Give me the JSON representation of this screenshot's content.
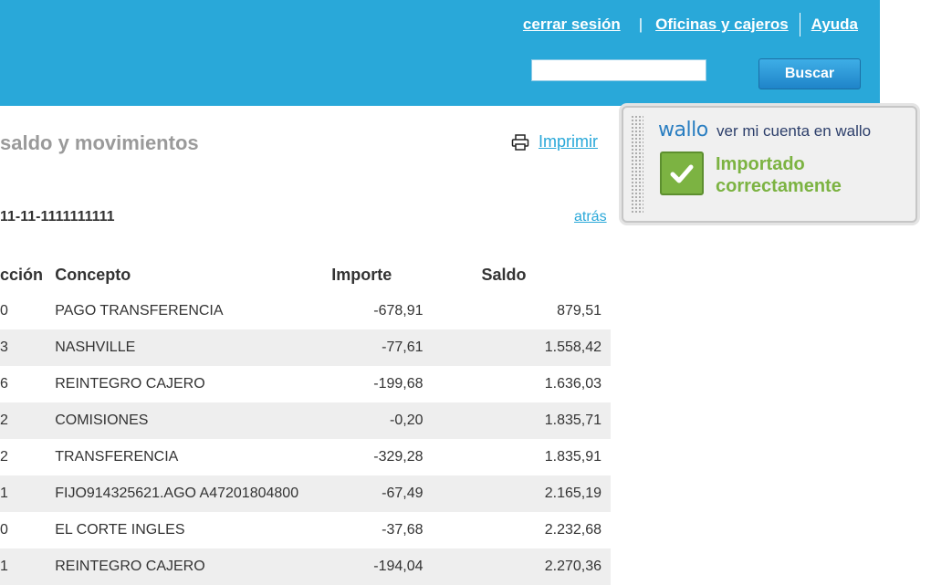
{
  "header": {
    "logout_label": "cerrar sesión",
    "separator": "|",
    "offices_label": "Oficinas y cajeros",
    "help_label": "Ayuda",
    "search_placeholder": "",
    "search_button": "Buscar"
  },
  "main": {
    "title": "saldo y movimientos",
    "print_label": "Imprimir",
    "account_number": "11-11-1111111111",
    "back_label": "atrás"
  },
  "table": {
    "headers": [
      "cción",
      "Concepto",
      "Importe",
      "Saldo"
    ],
    "rows": [
      {
        "date": "0",
        "concept": "PAGO TRANSFERENCIA",
        "amount": "-678,91",
        "balance": "879,51"
      },
      {
        "date": "3",
        "concept": "NASHVILLE",
        "amount": "-77,61",
        "balance": "1.558,42"
      },
      {
        "date": "6",
        "concept": "REINTEGRO CAJERO",
        "amount": "-199,68",
        "balance": "1.636,03"
      },
      {
        "date": "2",
        "concept": "COMISIONES",
        "amount": "-0,20",
        "balance": "1.835,71"
      },
      {
        "date": "2",
        "concept": "TRANSFERENCIA",
        "amount": "-329,28",
        "balance": "1.835,91"
      },
      {
        "date": "1",
        "concept": "FIJO914325621.AGO A47201804800",
        "amount": "-67,49",
        "balance": "2.165,19"
      },
      {
        "date": "0",
        "concept": "EL CORTE INGLES",
        "amount": "-37,68",
        "balance": "2.232,68"
      },
      {
        "date": "1",
        "concept": "REINTEGRO CAJERO",
        "amount": "-194,04",
        "balance": "2.270,36"
      }
    ]
  },
  "wallo": {
    "logo": "wallo",
    "account_link": "ver mi cuenta en wallo",
    "status_line1": "Importado",
    "status_line2": "correctamente",
    "status_icon": "check-icon",
    "accent_color": "#7cb342"
  },
  "colors": {
    "header_bg": "#29a8d9",
    "link": "#29a8d9",
    "row_alt": "#eeeeee"
  }
}
